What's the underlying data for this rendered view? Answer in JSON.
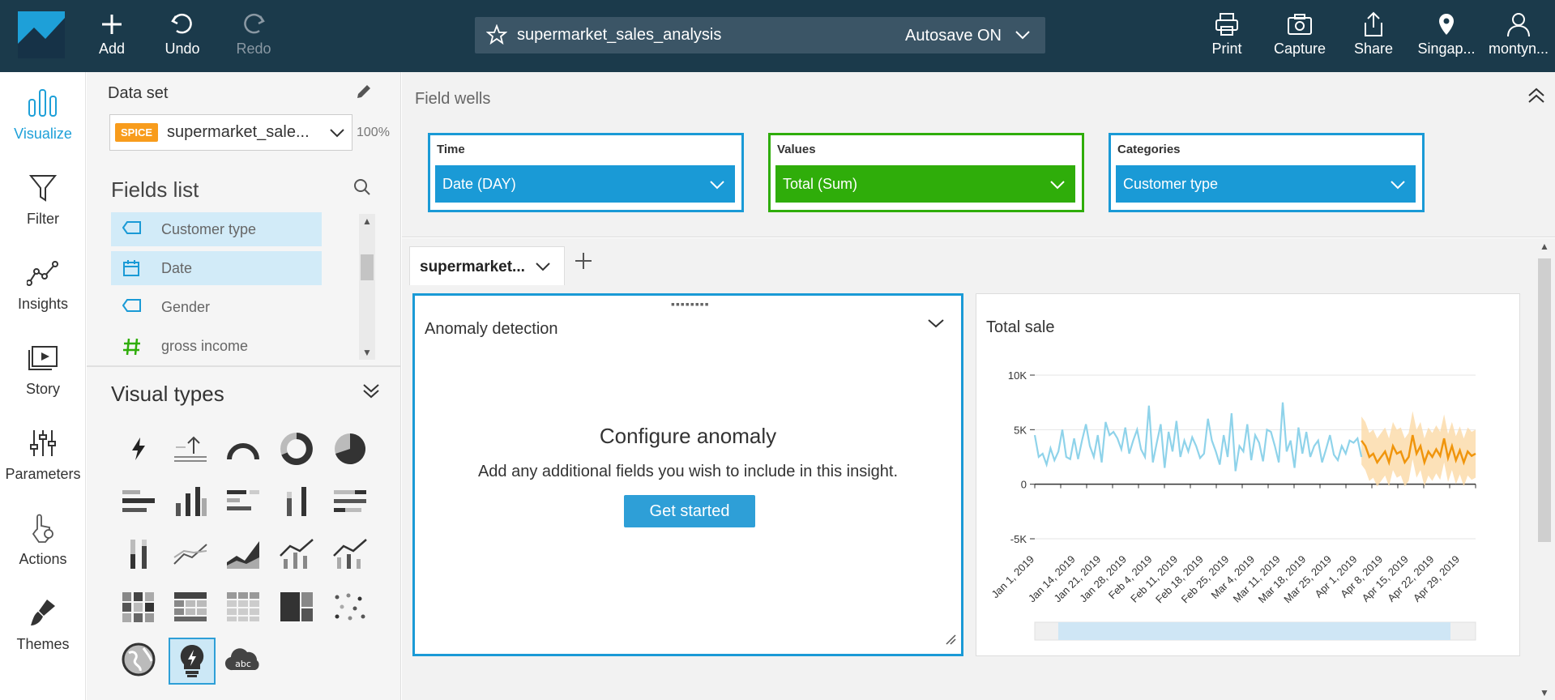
{
  "toolbar": {
    "add": "Add",
    "undo": "Undo",
    "redo": "Redo",
    "analysis_name": "supermarket_sales_analysis",
    "autosave": "Autosave ON",
    "print": "Print",
    "capture": "Capture",
    "share": "Share",
    "region": "Singap...",
    "user": "montyn..."
  },
  "leftnav": [
    "Visualize",
    "Filter",
    "Insights",
    "Story",
    "Parameters",
    "Actions",
    "Themes"
  ],
  "datapanel": {
    "title": "Data set",
    "badge": "SPICE",
    "dataset": "supermarket_sale...",
    "percent": "100%",
    "fields_title": "Fields list",
    "fields": [
      {
        "name": "Customer type",
        "type": "dimension",
        "selected": true
      },
      {
        "name": "Date",
        "type": "date",
        "selected": true
      },
      {
        "name": "Gender",
        "type": "dimension",
        "selected": false
      },
      {
        "name": "gross income",
        "type": "measure",
        "selected": false
      }
    ],
    "visual_types_title": "Visual types"
  },
  "fieldwells": {
    "title": "Field wells",
    "wells": [
      {
        "label": "Time",
        "value": "Date (DAY)",
        "color": "#1a9ad6"
      },
      {
        "label": "Values",
        "value": "Total (Sum)",
        "color": "#2fad0a"
      },
      {
        "label": "Categories",
        "value": "Customer type",
        "color": "#1a9ad6"
      }
    ]
  },
  "sheet": {
    "tab": "supermarket...",
    "anomaly": {
      "title": "Anomaly detection",
      "configure": "Configure anomaly",
      "description": "Add any additional fields you wish to include in this insight.",
      "button": "Get started"
    },
    "totalsale": {
      "title": "Total sale"
    }
  },
  "chart_data": {
    "type": "line",
    "title": "Total sale",
    "ylim": [
      -5000,
      10000
    ],
    "yticks": [
      "10K",
      "5K",
      "0",
      "-5K"
    ],
    "x_ticks": [
      "Jan 1, 2019",
      "Jan 14, 2019",
      "Jan 21, 2019",
      "Jan 28, 2019",
      "Feb 4, 2019",
      "Feb 11, 2019",
      "Feb 18, 2019",
      "Feb 25, 2019",
      "Mar 4, 2019",
      "Mar 11, 2019",
      "Mar 18, 2019",
      "Mar 25, 2019",
      "Apr 1, 2019",
      "Apr 8, 2019",
      "Apr 15, 2019",
      "Apr 22, 2019",
      "Apr 29, 2019"
    ],
    "series": [
      {
        "color": "#8fd3ea",
        "values": [
          4500,
          2500,
          2800,
          1800,
          3300,
          2200,
          3000,
          5000,
          2500,
          2300,
          4200,
          2300,
          4000,
          5500,
          3500,
          2500,
          4500,
          2000,
          5700,
          4500,
          4800,
          4200,
          3200,
          5200,
          2800,
          4000,
          5000,
          3200,
          2500,
          7200,
          2000,
          3800,
          5500,
          1500,
          4800,
          3000,
          5800,
          2500,
          4000,
          3000,
          4300,
          3500,
          2400,
          2800,
          6000,
          4000,
          3000,
          1800,
          4500,
          2500,
          6500,
          1200,
          3500,
          3000,
          5500,
          2200,
          4500,
          3800,
          2100,
          5000,
          4800,
          3500,
          2000,
          7500,
          3000,
          4000,
          1500,
          5200,
          2800,
          4800,
          2500,
          3500,
          4000,
          2000,
          3200,
          4500,
          2700,
          2200,
          3500,
          2800,
          4000,
          3800,
          4200,
          2500
        ]
      },
      {
        "color": "#f0950c",
        "values": [
          4000,
          3500,
          2500,
          2800,
          2000,
          2500,
          3000,
          2000,
          3500,
          2800,
          3000,
          2000,
          2500,
          4500,
          2800,
          3500,
          2000,
          3000,
          2500,
          3200,
          2600,
          4200,
          2400,
          3500,
          2200,
          3100,
          2000,
          3000,
          2600,
          2800
        ]
      }
    ]
  }
}
